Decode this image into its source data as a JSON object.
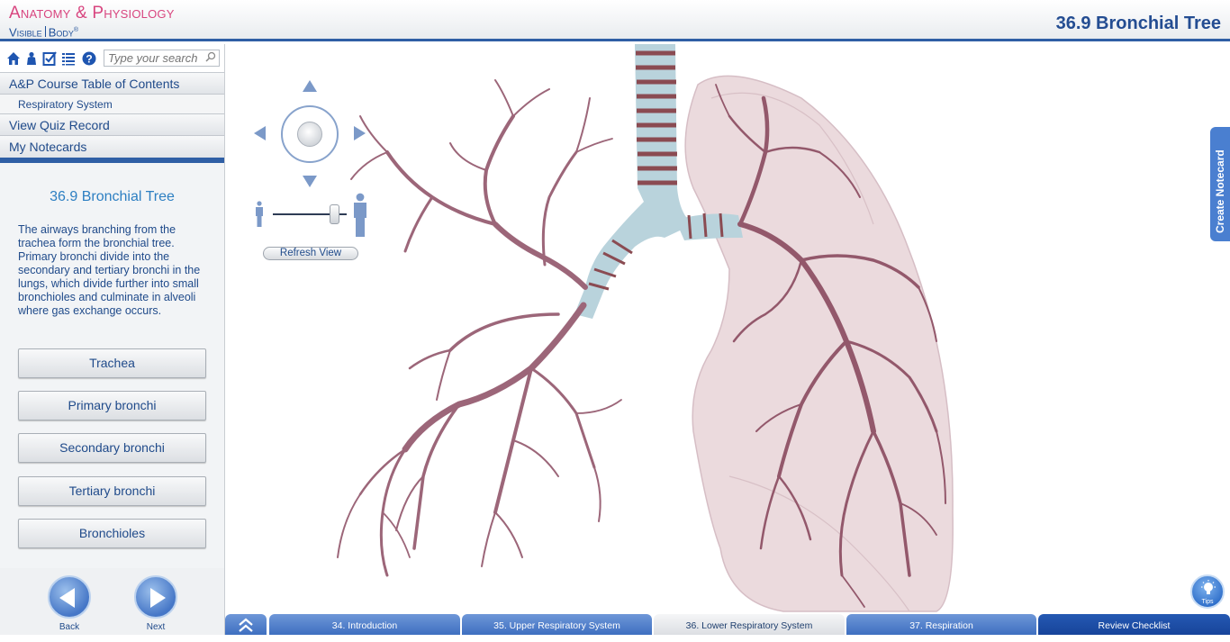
{
  "app": {
    "logo_line1": "Anatomy & Physiology",
    "logo_line2_a": "Visible",
    "logo_line2_b": "Body",
    "page_title": "36.9 Bronchial Tree"
  },
  "toolbar": {
    "icons": [
      "home-icon",
      "person-icon",
      "checklist-icon",
      "list-icon",
      "help-icon"
    ],
    "search_placeholder": "Type your search"
  },
  "sidebar": {
    "toc_label": "A&P Course Table of Contents",
    "toc_sub": "Respiratory System",
    "quiz_label": "View Quiz Record",
    "notecards_label": "My Notecards",
    "section_title": "36.9 Bronchial Tree",
    "description": "The airways branching from the trachea form the bronchial tree. Primary bronchi divide into the secondary and tertiary bronchi in the lungs, which divide further into small bronchioles and culminate in alveoli where gas exchange occurs.",
    "buttons": [
      "Trachea",
      "Primary bronchi",
      "Secondary bronchi",
      "Tertiary bronchi",
      "Bronchioles"
    ],
    "back_label": "Back",
    "next_label": "Next"
  },
  "viewer": {
    "refresh_label": "Refresh View",
    "create_notecard_label": "Create Notecard",
    "tips_label": "Tips"
  },
  "bottom_tabs": {
    "items": [
      "34. Introduction",
      "35. Upper Respiratory System",
      "36. Lower Respiratory System",
      "37. Respiration",
      "Review Checklist"
    ],
    "active_index": 2
  },
  "colors": {
    "brand_pink": "#d8457f",
    "brand_blue": "#1e4f99",
    "accent_blue": "#2f5fa5",
    "bronchi": "#9c6679",
    "lung": "#e8d3d8"
  }
}
